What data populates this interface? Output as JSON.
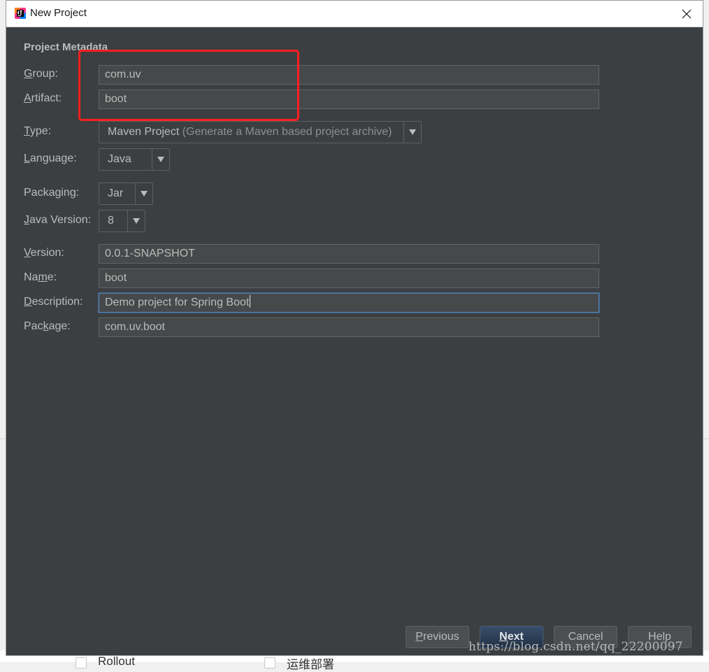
{
  "window": {
    "title": "New Project"
  },
  "section_title": "Project Metadata",
  "fields": {
    "group": {
      "label_prefix": "",
      "mnemonic": "G",
      "label_suffix": "roup:",
      "value": "com.uv"
    },
    "artifact": {
      "label_prefix": "",
      "mnemonic": "A",
      "label_suffix": "rtifact:",
      "value": "boot"
    },
    "version": {
      "label_prefix": "",
      "mnemonic": "V",
      "label_suffix": "ersion:",
      "value": "0.0.1-SNAPSHOT"
    },
    "name": {
      "label_prefix": "Na",
      "mnemonic": "m",
      "label_suffix": "e:",
      "value": "boot"
    },
    "description": {
      "label_prefix": "",
      "mnemonic": "D",
      "label_suffix": "escription:",
      "value": "Demo project for Spring Boot"
    },
    "package": {
      "label_prefix": "Pac",
      "mnemonic": "k",
      "label_suffix": "age:",
      "value": "com.uv.boot"
    }
  },
  "selects": {
    "type": {
      "label_prefix": "",
      "mnemonic": "T",
      "label_suffix": "ype:",
      "value": "Maven Project",
      "hint": "(Generate a Maven based project archive)"
    },
    "language": {
      "label_prefix": "",
      "mnemonic": "L",
      "label_suffix": "anguage:",
      "value": "Java"
    },
    "packaging": {
      "label_prefix": "Packa",
      "mnemonic": "g",
      "label_suffix": "ing:",
      "value": "Jar"
    },
    "java_version": {
      "label_prefix": "",
      "mnemonic": "J",
      "label_suffix": "ava Version:",
      "value": "8"
    }
  },
  "buttons": {
    "previous": {
      "mnemonic": "P",
      "rest": "revious"
    },
    "next": {
      "mnemonic": "N",
      "rest": "ext"
    },
    "cancel": {
      "label": "Cancel"
    },
    "help": {
      "label": "Help"
    }
  },
  "background": {
    "item1": "Rollout",
    "item2": "运维部署"
  },
  "watermark": "https://blog.csdn.net/qq_22200097",
  "colors": {
    "dialog_bg": "#3c3f41",
    "field_bg": "#45494a",
    "text": "#bbbbbb",
    "annotation": "#ff1f1f",
    "default_button": "#2f4560"
  },
  "icons": {
    "app": "intellij-idea-icon",
    "close": "close-icon",
    "dropdown": "triangle-down-icon"
  }
}
